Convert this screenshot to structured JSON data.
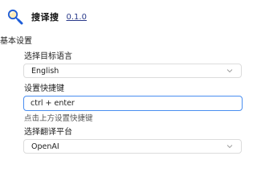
{
  "header": {
    "app_title": "搜译搜",
    "version": "0.1.0"
  },
  "section": {
    "title": "基本设置"
  },
  "target_language": {
    "label": "选择目标语言",
    "selected": "English"
  },
  "shortcut": {
    "label": "设置快捷键",
    "value": "ctrl + enter",
    "hint": "点击上方设置快捷键"
  },
  "platform": {
    "label": "选择翻译平台",
    "selected": "OpenAI"
  },
  "colors": {
    "accent": "#4a8ef0",
    "link": "#2a3a8a",
    "border": "#dcdcdc"
  }
}
